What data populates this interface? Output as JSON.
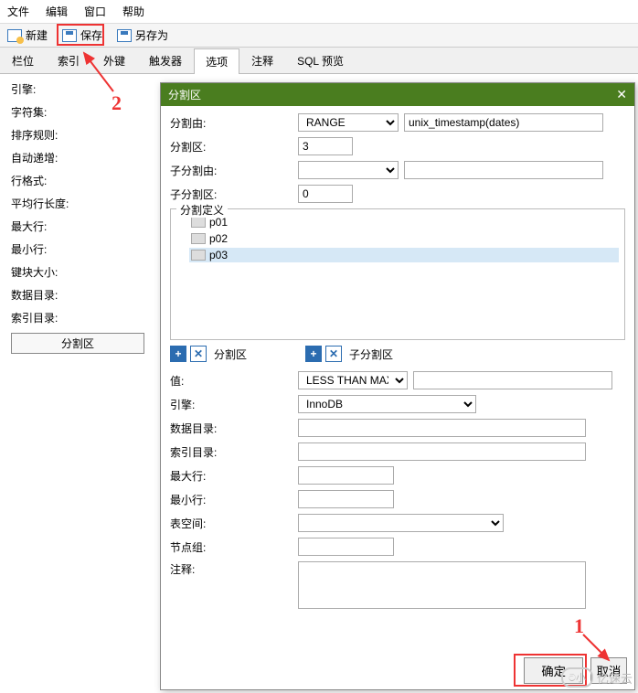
{
  "menubar": {
    "file": "文件",
    "edit": "编辑",
    "window": "窗口",
    "help": "帮助"
  },
  "toolbar": {
    "new": "新建",
    "save": "保存",
    "saveas": "另存为"
  },
  "tabs": {
    "col": "栏位",
    "idx": "索引",
    "fk": "外键",
    "trg": "触发器",
    "opt": "选项",
    "cmt": "注释",
    "sql": "SQL 预览"
  },
  "left": {
    "engine": "引擎:",
    "charset": "字符集:",
    "collation": "排序规则:",
    "autoinc": "自动递增:",
    "rowfmt": "行格式:",
    "avglen": "平均行长度:",
    "maxrow": "最大行:",
    "minrow": "最小行:",
    "keyblk": "键块大小:",
    "datadir": "数据目录:",
    "idxdir": "索引目录:",
    "heading": "分割区"
  },
  "modal": {
    "title": "分割区",
    "labels": {
      "partby": "分割由:",
      "parts": "分割区:",
      "subby": "子分割由:",
      "subparts": "子分割区:",
      "defs": "分割定义",
      "partsec": "分割区",
      "subsec": "子分割区",
      "value": "值:",
      "engine": "引擎:",
      "datadir": "数据目录:",
      "idxdir": "索引目录:",
      "maxrow": "最大行:",
      "minrow": "最小行:",
      "tbs": "表空间:",
      "nodegrp": "节点组:",
      "comment": "注释:"
    },
    "values": {
      "partby": "RANGE",
      "partexpr": "unix_timestamp(dates)",
      "parts": "3",
      "subparts": "0",
      "defs": [
        "p01",
        "p02",
        "p03"
      ],
      "selected": "p03",
      "value": "LESS THAN MAX",
      "engine": "InnoDB"
    },
    "buttons": {
      "ok": "确定",
      "cancel": "取消"
    }
  },
  "annotations": {
    "one": "1",
    "two": "2"
  },
  "watermark": {
    "icon": "ට小",
    "text": "亿速云"
  }
}
